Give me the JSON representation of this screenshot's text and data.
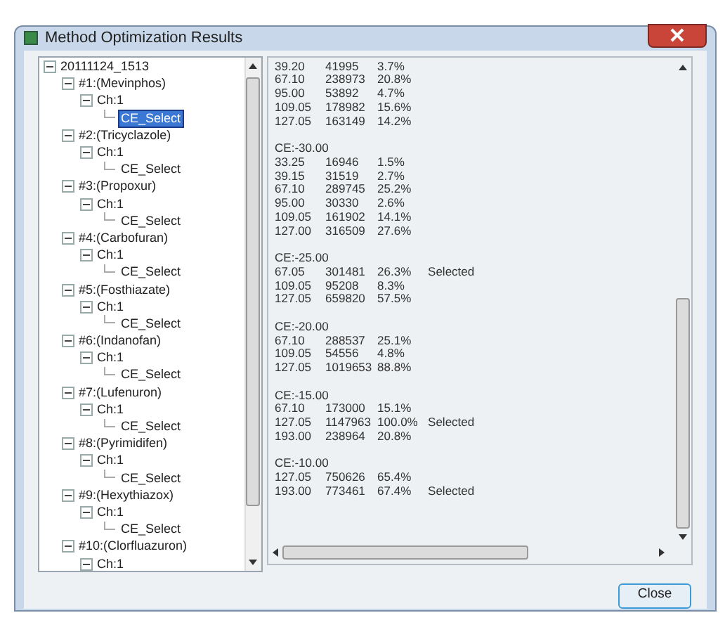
{
  "window": {
    "title": "Method Optimization Results"
  },
  "tree": {
    "label": "20111124_1513",
    "expanded": true,
    "children": [
      {
        "label": "#1:(Mevinphos)",
        "expanded": true,
        "children": [
          {
            "label": "Ch:1",
            "expanded": true,
            "children": [
              {
                "label": "CE_Select",
                "selected": true
              }
            ]
          }
        ]
      },
      {
        "label": "#2:(Tricyclazole)",
        "expanded": true,
        "children": [
          {
            "label": "Ch:1",
            "expanded": true,
            "children": [
              {
                "label": "CE_Select",
                "selected": false
              }
            ]
          }
        ]
      },
      {
        "label": "#3:(Propoxur)",
        "expanded": true,
        "children": [
          {
            "label": "Ch:1",
            "expanded": true,
            "children": [
              {
                "label": "CE_Select",
                "selected": false
              }
            ]
          }
        ]
      },
      {
        "label": "#4:(Carbofuran)",
        "expanded": true,
        "children": [
          {
            "label": "Ch:1",
            "expanded": true,
            "children": [
              {
                "label": "CE_Select",
                "selected": false
              }
            ]
          }
        ]
      },
      {
        "label": "#5:(Fosthiazate)",
        "expanded": true,
        "children": [
          {
            "label": "Ch:1",
            "expanded": true,
            "children": [
              {
                "label": "CE_Select",
                "selected": false
              }
            ]
          }
        ]
      },
      {
        "label": "#6:(Indanofan)",
        "expanded": true,
        "children": [
          {
            "label": "Ch:1",
            "expanded": true,
            "children": [
              {
                "label": "CE_Select",
                "selected": false
              }
            ]
          }
        ]
      },
      {
        "label": "#7:(Lufenuron)",
        "expanded": true,
        "children": [
          {
            "label": "Ch:1",
            "expanded": true,
            "children": [
              {
                "label": "CE_Select",
                "selected": false
              }
            ]
          }
        ]
      },
      {
        "label": "#8:(Pyrimidifen)",
        "expanded": true,
        "children": [
          {
            "label": "Ch:1",
            "expanded": true,
            "children": [
              {
                "label": "CE_Select",
                "selected": false
              }
            ]
          }
        ]
      },
      {
        "label": "#9:(Hexythiazox)",
        "expanded": true,
        "children": [
          {
            "label": "Ch:1",
            "expanded": true,
            "children": [
              {
                "label": "CE_Select",
                "selected": false
              }
            ]
          }
        ]
      },
      {
        "label": "#10:(Clorfluazuron)",
        "expanded": true,
        "children": [
          {
            "label": "Ch:1",
            "expanded": true
          }
        ]
      }
    ]
  },
  "results": {
    "groups": [
      {
        "rows": [
          [
            "39.20",
            "41995",
            "3.7%"
          ],
          [
            "67.10",
            "238973",
            "20.8%"
          ],
          [
            "95.00",
            "53892",
            "4.7%"
          ],
          [
            "109.05",
            "178982",
            "15.6%"
          ],
          [
            "127.05",
            "163149",
            "14.2%"
          ]
        ]
      },
      {
        "header": "CE:-30.00",
        "rows": [
          [
            "33.25",
            "16946",
            "1.5%"
          ],
          [
            "39.15",
            "31519",
            "2.7%"
          ],
          [
            "67.10",
            "289745",
            "25.2%"
          ],
          [
            "95.00",
            "30330",
            "2.6%"
          ],
          [
            "109.05",
            "161902",
            "14.1%"
          ],
          [
            "127.00",
            "316509",
            "27.6%"
          ]
        ]
      },
      {
        "header": "CE:-25.00",
        "rows": [
          [
            "67.05",
            "301481",
            "26.3%",
            "Selected"
          ],
          [
            "109.05",
            "95208",
            "8.3%"
          ],
          [
            "127.05",
            "659820",
            "57.5%"
          ]
        ]
      },
      {
        "header": "CE:-20.00",
        "rows": [
          [
            "67.10",
            "288537",
            "25.1%"
          ],
          [
            "109.05",
            "54556",
            "4.8%"
          ],
          [
            "127.05",
            "1019653",
            "88.8%"
          ]
        ]
      },
      {
        "header": "CE:-15.00",
        "rows": [
          [
            "67.10",
            "173000",
            "15.1%"
          ],
          [
            "127.05",
            "1147963",
            "100.0%",
            "Selected"
          ],
          [
            "193.00",
            "238964",
            "20.8%"
          ]
        ]
      },
      {
        "header": "CE:-10.00",
        "rows": [
          [
            "127.05",
            "750626",
            "65.4%"
          ],
          [
            "193.00",
            "773461",
            "67.4%",
            "Selected"
          ]
        ]
      }
    ]
  },
  "buttons": [
    {
      "label": "Close"
    }
  ]
}
